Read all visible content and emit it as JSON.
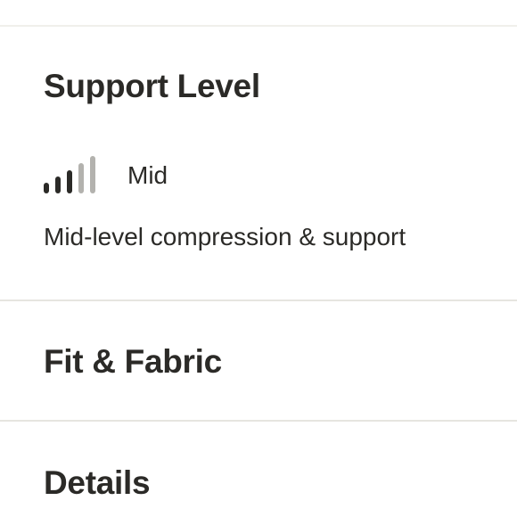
{
  "support": {
    "title": "Support Level",
    "level_label": "Mid",
    "level_value": 3,
    "level_max": 5,
    "description": "Mid-level compression & support",
    "bar_active_color": "#2b2a27",
    "bar_inactive_color": "#b3b2ae"
  },
  "fit": {
    "title": "Fit & Fabric"
  },
  "details": {
    "title": "Details"
  }
}
